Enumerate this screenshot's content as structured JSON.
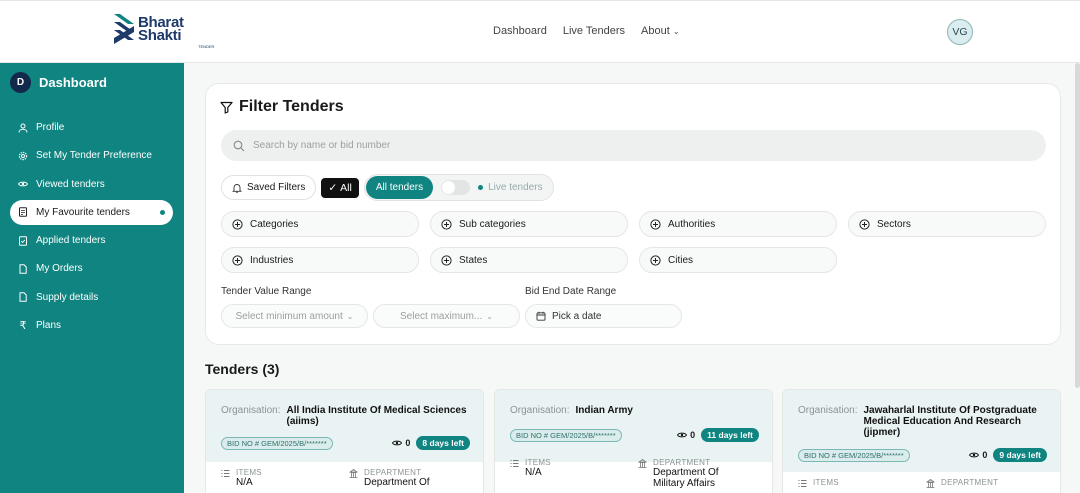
{
  "brand": {
    "line1": "Bharat",
    "line2": "Shakti",
    "sub": "TENDER",
    "color": "#1d3a6b"
  },
  "nav": {
    "items": [
      "Dashboard",
      "Live Tenders",
      "About"
    ],
    "user_initials": "VG"
  },
  "sidebar": {
    "avatar_letter": "D",
    "title": "Dashboard",
    "items": [
      {
        "label": "Profile",
        "icon": "user-icon"
      },
      {
        "label": "Set My Tender Preference",
        "icon": "gear-icon"
      },
      {
        "label": "Viewed tenders",
        "icon": "eye-icon"
      },
      {
        "label": "My Favourite tenders",
        "icon": "bookmark-icon",
        "active": true
      },
      {
        "label": "Applied tenders",
        "icon": "file-check-icon"
      },
      {
        "label": "My Orders",
        "icon": "file-icon"
      },
      {
        "label": "Supply details",
        "icon": "file-icon"
      },
      {
        "label": "Plans",
        "icon": "rupee-icon"
      }
    ],
    "accent": "#0f8480"
  },
  "filter": {
    "title": "Filter Tenders",
    "search_placeholder": "Search by name or bid number",
    "saved_filters": "Saved Filters",
    "all_label": "All",
    "all_tenders": "All tenders",
    "live_tenders": "Live tenders",
    "live_toggle_on": false,
    "chips": [
      "Categories",
      "Sub categories",
      "Authorities",
      "Sectors",
      "Industries",
      "States",
      "Cities"
    ],
    "value_range_label": "Tender Value Range",
    "min_placeholder": "Select minimum amount",
    "max_placeholder": "Select maximum...",
    "date_range_label": "Bid End Date Range",
    "date_button": "Pick a date"
  },
  "tenders": {
    "title": "Tenders (3)",
    "cards": [
      {
        "org_label": "Organisation:",
        "org_name": "All India Institute Of Medical Sciences (aiims)",
        "bid": "BID NO # GEM/2025/B/*******",
        "views": "0",
        "days_left": "8 days left",
        "items_label": "ITEMS",
        "items_value": "N/A",
        "dept_label": "DEPARTMENT",
        "dept_value": "Department Of"
      },
      {
        "org_label": "Organisation:",
        "org_name": "Indian Army",
        "bid": "BID NO # GEM/2025/B/*******",
        "views": "0",
        "days_left": "11 days left",
        "items_label": "ITEMS",
        "items_value": "N/A",
        "dept_label": "DEPARTMENT",
        "dept_value": "Department Of Military Affairs"
      },
      {
        "org_label": "Organisation:",
        "org_name": "Jawaharlal Institute Of Postgraduate Medical Education And Research (jipmer)",
        "bid": "BID NO # GEM/2025/B/*******",
        "views": "0",
        "days_left": "9 days left",
        "items_label": "ITEMS",
        "items_value": "",
        "dept_label": "DEPARTMENT",
        "dept_value": ""
      }
    ]
  }
}
